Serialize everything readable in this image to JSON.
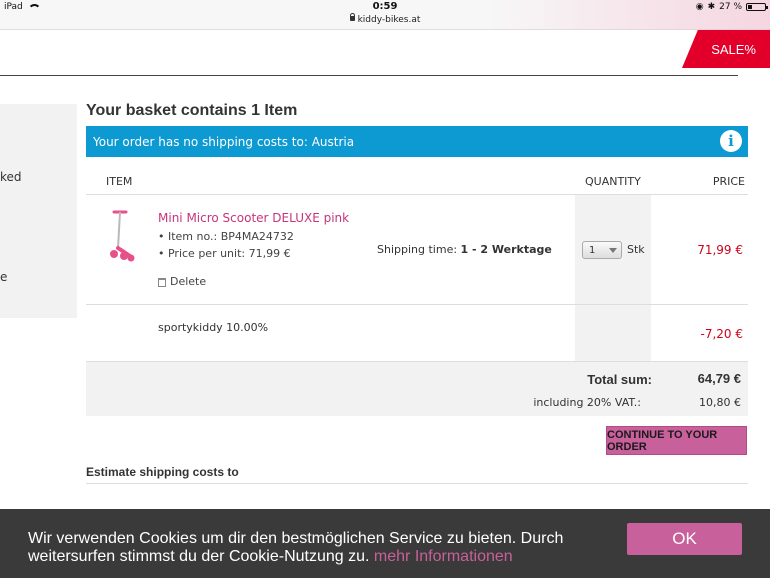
{
  "status_bar": {
    "device": "iPad",
    "time": "0:59",
    "url": "kiddy-bikes.at",
    "battery": "27 %",
    "battery_level": 0.27
  },
  "header": {
    "sale_label": "SALE%"
  },
  "left_panel": {
    "text_1": "ked",
    "text_2": "e"
  },
  "basket": {
    "title": "Your basket contains 1 Item",
    "shipping_notice": "Your order has no shipping costs to: Austria",
    "columns": {
      "item": "ITEM",
      "quantity": "QUANTITY",
      "price": "PRICE"
    },
    "item": {
      "name": "Mini Micro Scooter DELUXE pink",
      "item_no": "• Item no.: BP4MA24732",
      "price_per_unit": "• Price per unit: 71,99 €",
      "delete_label": "Delete",
      "shipping_time_label": "Shipping time:",
      "shipping_time_value": "1 - 2 Werktage",
      "quantity": "1",
      "unit": "Stk",
      "price": "71,99 €"
    },
    "discount": {
      "label": "sportykiddy 10.00%",
      "value": "-7,20 €"
    },
    "totals": {
      "total_label": "Total sum:",
      "total_value": "64,79 €",
      "vat_label": "including 20% VAT.:",
      "vat_value": "10,80 €"
    },
    "continue_label": "CONTINUE TO YOUR ORDER",
    "estimate_label": "Estimate shipping costs to"
  },
  "cookie_bar": {
    "text": "Wir verwenden Cookies um dir den bestmöglichen Service zu bieten. Durch weitersurfen stimmst du der Cookie-Nutzung zu.",
    "link_label": "mehr Informationen",
    "ok_label": "OK"
  },
  "colors": {
    "accent_pink": "#c8609b",
    "info_blue": "#0d9ad2",
    "sale_red": "#e2002a",
    "price_red": "#d0021b"
  }
}
